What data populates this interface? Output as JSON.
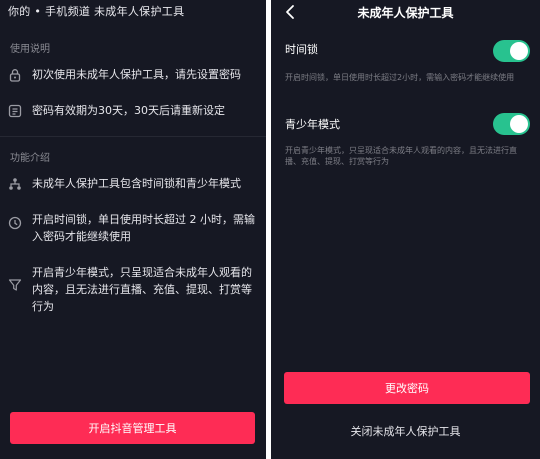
{
  "left": {
    "title": "你的 • 手机频道 未成年人保护工具",
    "usage_section": "使用说明",
    "usage_items": [
      {
        "icon": "lock-icon",
        "text": "初次使用未成年人保护工具，请先设置密码"
      },
      {
        "icon": "password-icon",
        "text": "密码有效期为30天，30天后请重新设定"
      }
    ],
    "features_section": "功能介绍",
    "feature_items": [
      {
        "icon": "hierarchy-icon",
        "text": "未成年人保护工具包含时间锁和青少年模式"
      },
      {
        "icon": "clock-icon",
        "text": "开启时间锁，单日使用时长超过 2 小时，需输入密码才能继续使用"
      },
      {
        "icon": "filter-icon",
        "text": "开启青少年模式，只呈现适合未成年人观看的内容，且无法进行直播、充值、提现、打赏等行为"
      }
    ],
    "button_label": "开启抖音管理工具"
  },
  "right": {
    "title": "未成年人保护工具",
    "time_lock": {
      "label": "时间锁",
      "description": "开启时间锁，单日使用时长超过2小时，需输入密码才能继续使用",
      "enabled": true
    },
    "teen_mode": {
      "label": "青少年模式",
      "description": "开启青少年模式，只呈现适合未成年人观看的内容，且无法进行直播、充值、提现、打赏等行为",
      "enabled": true
    },
    "change_password_label": "更改密码",
    "close_tool_label": "关闭未成年人保护工具"
  },
  "colors": {
    "background": "#161823",
    "accent": "#fe2c55",
    "toggle_on": "#28c28f"
  }
}
